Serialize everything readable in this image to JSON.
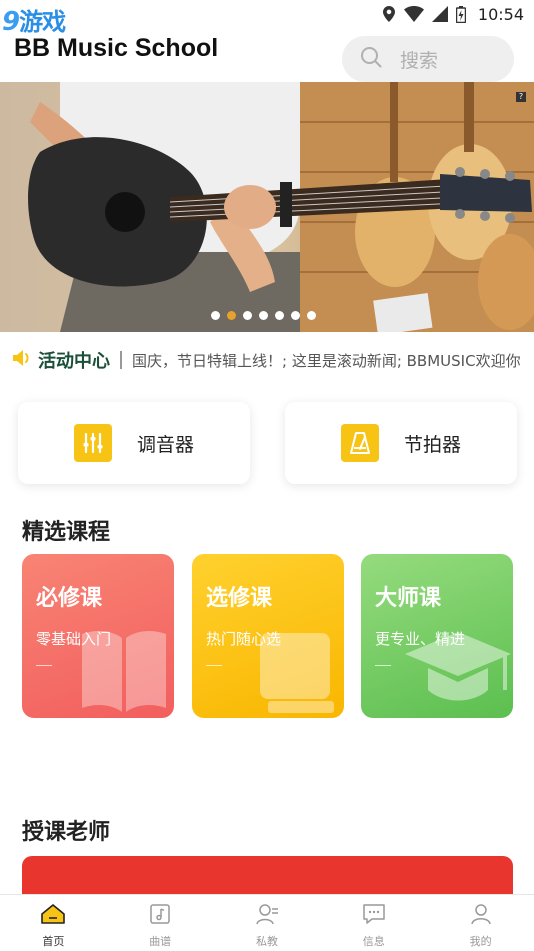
{
  "status_bar": {
    "time": "10:54"
  },
  "watermark": {
    "num": "9",
    "text": "游戏"
  },
  "header": {
    "title": "BB Music School",
    "search_placeholder": "搜索"
  },
  "banner": {
    "dot_count": 7,
    "active_dot": 1,
    "mark": "?"
  },
  "notice": {
    "title": "活动中心",
    "text": "国庆，节日特辑上线！; 这里是滚动新闻; BBMUSIC欢迎你"
  },
  "tools": [
    {
      "label": "调音器",
      "icon": "tuner-icon"
    },
    {
      "label": "节拍器",
      "icon": "metronome-icon"
    }
  ],
  "courses_section": {
    "title": "精选课程"
  },
  "courses": [
    {
      "title": "必修课",
      "subtitle": "零基础入门",
      "color_from": "#f87a6c",
      "color_to": "#f25c5c",
      "icon": "book-icon"
    },
    {
      "title": "选修课",
      "subtitle": "热门随心选",
      "color_from": "#ffd02a",
      "color_to": "#f8b800",
      "icon": "notebook-icon"
    },
    {
      "title": "大师课",
      "subtitle": "更专业、精进",
      "color_from": "#8fd777",
      "color_to": "#5dbf50",
      "icon": "graduation-cap-icon"
    }
  ],
  "teachers_section": {
    "title": "授课老师"
  },
  "nav": [
    {
      "label": "首页",
      "icon": "home-icon",
      "active": true
    },
    {
      "label": "曲谱",
      "icon": "sheet-music-icon",
      "active": false
    },
    {
      "label": "私教",
      "icon": "tutor-icon",
      "active": false
    },
    {
      "label": "信息",
      "icon": "message-icon",
      "active": false
    },
    {
      "label": "我的",
      "icon": "profile-icon",
      "active": false
    }
  ],
  "colors": {
    "accent_yellow": "#f7c315",
    "active_dot": "#e8a12a",
    "teacher_banner": "#e8352e"
  }
}
